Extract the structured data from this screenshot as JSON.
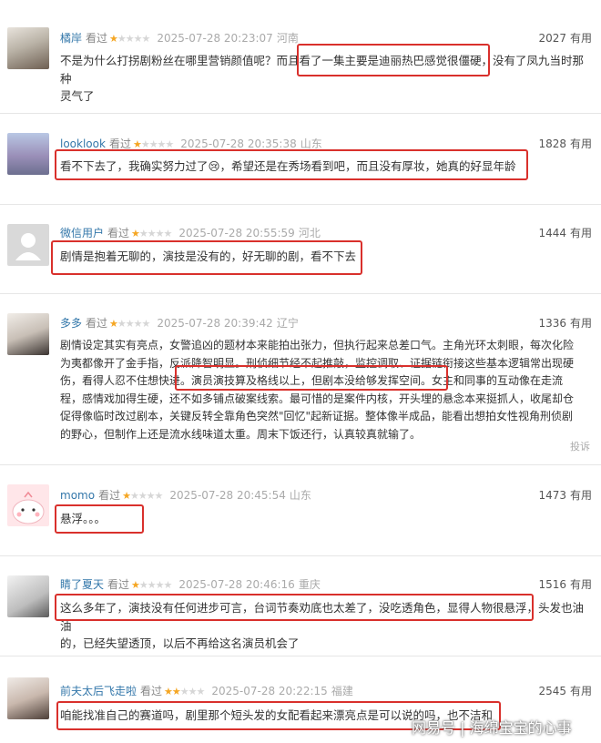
{
  "reviews": [
    {
      "user": "橘岸",
      "seen": "看过",
      "rating": 1,
      "time": "2025-07-28 20:23:07",
      "location": "河南",
      "useful_count": "2027",
      "useful_label": "有用",
      "lines": [
        "不是为什么打拐剧粉丝在哪里营销颜值呢？而且看了一集主要是迪丽热巴感觉很僵硬，没有了凤九当时那种",
        "灵气了"
      ]
    },
    {
      "user": "looklook",
      "seen": "看过",
      "rating": 1,
      "time": "2025-07-28 20:35:38",
      "location": "山东",
      "useful_count": "1828",
      "useful_label": "有用",
      "lines": [
        "看不下去了，我确实努力过了😢，希望还是在秀场看到吧，而且没有厚妆，她真的好显年龄"
      ]
    },
    {
      "user": "微信用户",
      "seen": "看过",
      "rating": 1,
      "time": "2025-07-28 20:55:59",
      "location": "河北",
      "useful_count": "1444",
      "useful_label": "有用",
      "lines": [
        "剧情是抱着无聊的，演技是没有的，好无聊的剧，看不下去"
      ]
    },
    {
      "user": "多多",
      "seen": "看过",
      "rating": 1,
      "time": "2025-07-28 20:39:42",
      "location": "辽宁",
      "useful_count": "1336",
      "useful_label": "有用",
      "lines": [
        "剧情设定其实有亮点，女警追凶的题材本来能拍出张力，但执行起来总差口气。主角光环太刺眼，每次化险",
        "为夷都像开了金手指，反派降智明显。刑侦细节经不起推敲，监控调取、证据链衔接这些基本逻辑常出现硬",
        "伤，看得人忍不住想快进。演员演技算及格线以上，但剧本没给够发挥空间。女主和同事的互动像在走流",
        "程，感情戏加得生硬，还不如多铺点破案线索。最可惜的是案件内核，开头埋的悬念本来挺抓人，收尾却仓",
        "促得像临时改过剧本，关键反转全靠角色突然\"回忆\"起新证据。整体像半成品，能看出想拍女性视角刑侦剧",
        "的野心，但制作上还是流水线味道太重。周末下饭还行，认真较真就输了。"
      ],
      "report": "投诉"
    },
    {
      "user": "momo",
      "seen": "看过",
      "rating": 1,
      "time": "2025-07-28 20:45:54",
      "location": "山东",
      "useful_count": "1473",
      "useful_label": "有用",
      "lines": [
        "悬浮。。。"
      ]
    },
    {
      "user": "睛了夏天",
      "seen": "看过",
      "rating": 1,
      "time": "2025-07-28 20:46:16",
      "location": "重庆",
      "useful_count": "1516",
      "useful_label": "有用",
      "lines": [
        "这么多年了，演技没有任何进步可言，台词节奏劝底也太差了，没吃透角色，显得人物很悬浮，头发也油油",
        "的，已经失望透顶，以后不再给这名演员机会了"
      ]
    },
    {
      "user": "前夫太后飞走啦",
      "seen": "看过",
      "rating": 2,
      "time": "2025-07-28 20:22:15",
      "location": "福建",
      "useful_count": "2545",
      "useful_label": "有用",
      "lines": [
        "咱能找准自己的赛道吗，剧里那个短头发的女配看起来漂亮点是可以说的吗，也不洁和"
      ]
    }
  ],
  "watermark": "网易号 | 海绵宝宝的心事",
  "colors": {
    "highlight": "#d9302c",
    "username": "#3377aa",
    "star": "#f5a623"
  }
}
